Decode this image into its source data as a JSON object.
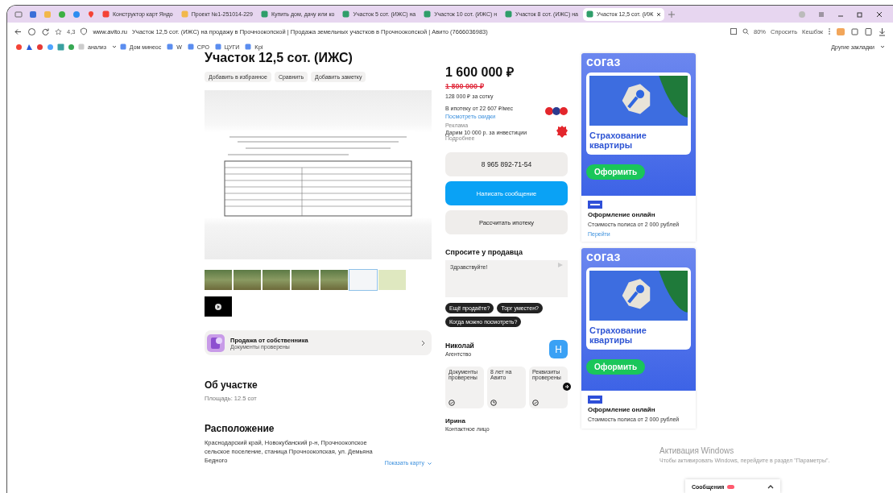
{
  "browser": {
    "tabs": [
      {
        "label": "Конструктор карт Яндо",
        "kind": "maps",
        "selected": false
      },
      {
        "label": "Проект №1-251014-229",
        "kind": "doc",
        "selected": false
      },
      {
        "label": "Купить дом, дачу или ко",
        "kind": "avito",
        "selected": false
      },
      {
        "label": "Участок 5 сот. (ИЖС) на",
        "kind": "avito",
        "selected": false
      },
      {
        "label": "Участок 10 сот. (ИЖС) н",
        "kind": "avito",
        "selected": false
      },
      {
        "label": "Участок 8 сот. (ИЖС) на",
        "kind": "avito",
        "selected": false
      },
      {
        "label": "Участок 12,5 сот. (ИЖ",
        "kind": "avito",
        "selected": true
      }
    ],
    "rating": "4,3",
    "url": "www.avito.ru",
    "page_title": "Участок 12,5 сот. (ИЖС) на продажу в Прочноокопской | Продажа земельных участков в Прочноокопской | Авито (7666036983)",
    "zoom": "80%",
    "actions": [
      "Спросить",
      "Кешбэк"
    ],
    "bookmarks": [
      {
        "label": "анализ",
        "kind": "folder"
      },
      {
        "label": "Дом минеос",
        "kind": "page"
      },
      {
        "label": "W",
        "kind": "page"
      },
      {
        "label": "СРО",
        "kind": "page"
      },
      {
        "label": "ЦУГИ",
        "kind": "page"
      },
      {
        "label": "Kpi",
        "kind": "page"
      }
    ],
    "other_bookmarks": "Другие закладки"
  },
  "listing": {
    "title": "Участок 12,5 сот. (ИЖС)",
    "actions": [
      "Добавить в избранное",
      "Сравнить",
      "Добавить заметку"
    ],
    "thumbnails": [
      {
        "kind": "photo",
        "selected": false
      },
      {
        "kind": "photo",
        "selected": false
      },
      {
        "kind": "photo",
        "selected": false
      },
      {
        "kind": "photo",
        "selected": false
      },
      {
        "kind": "photo",
        "selected": false
      },
      {
        "kind": "document",
        "selected": true
      },
      {
        "kind": "plan",
        "selected": false
      }
    ],
    "owner": {
      "title": "Продажа от собственника",
      "subtitle": "Документы проверены"
    },
    "about": {
      "heading": "Об участке",
      "area": "Площадь: 12.5 сот"
    },
    "location": {
      "heading": "Расположение",
      "address": "Краснодарский край, Новокубанский р-н, Прочноокопское сельское поселение, станица Прочноокопская, ул. Демьяна Бедного",
      "map_link": "Показать карту"
    }
  },
  "offer": {
    "price": "1 600 000 ₽",
    "old_price": "1 800 000 ₽",
    "per_sotka": "128 000 ₽ за сотку",
    "mortgage": "В ипотеку от 22 607 ₽/мес",
    "mortgage_link": "Посмотреть скидки",
    "promo_label": "Реклама",
    "promo": "Дарим 10 000 р. за инвестиции",
    "promo_link": "Подробнее",
    "phone": "8 965 892-71-54",
    "write_button": "Написать сообщение",
    "mortgage_button": "Рассчитать ипотеку",
    "ask": {
      "heading": "Спросите у продавца",
      "message": "Здравствуйте!",
      "suggestions": [
        "Ещё продаёте?",
        "Торг уместен?",
        "Когда можно посмотреть?"
      ]
    },
    "seller": {
      "name": "Николай",
      "type": "Агентство",
      "initial": "Н",
      "badges": [
        {
          "text": "Документы проверены"
        },
        {
          "text": "8 лет на Авито"
        },
        {
          "text": "Реквизиты проверены"
        }
      ]
    },
    "contact": {
      "name": "Ирина",
      "role": "Контактное лицо"
    }
  },
  "ads": [
    {
      "brand": "согаз",
      "headline": "Страхование квартиры",
      "cta": "Оформить",
      "title": "Оформление онлайн",
      "text": "Стоимость полиса от 2 000 рублей",
      "link": "Перейти"
    },
    {
      "brand": "согаз",
      "headline": "Страхование квартиры",
      "cta": "Оформить",
      "title": "Оформление онлайн",
      "text": "Стоимость полиса от 2 000 рублей"
    }
  ],
  "activation": {
    "title": "Активация Windows",
    "text": "Чтобы активировать Windows, перейдите в раздел \"Параметры\"."
  },
  "messages": {
    "label": "Сообщения"
  }
}
